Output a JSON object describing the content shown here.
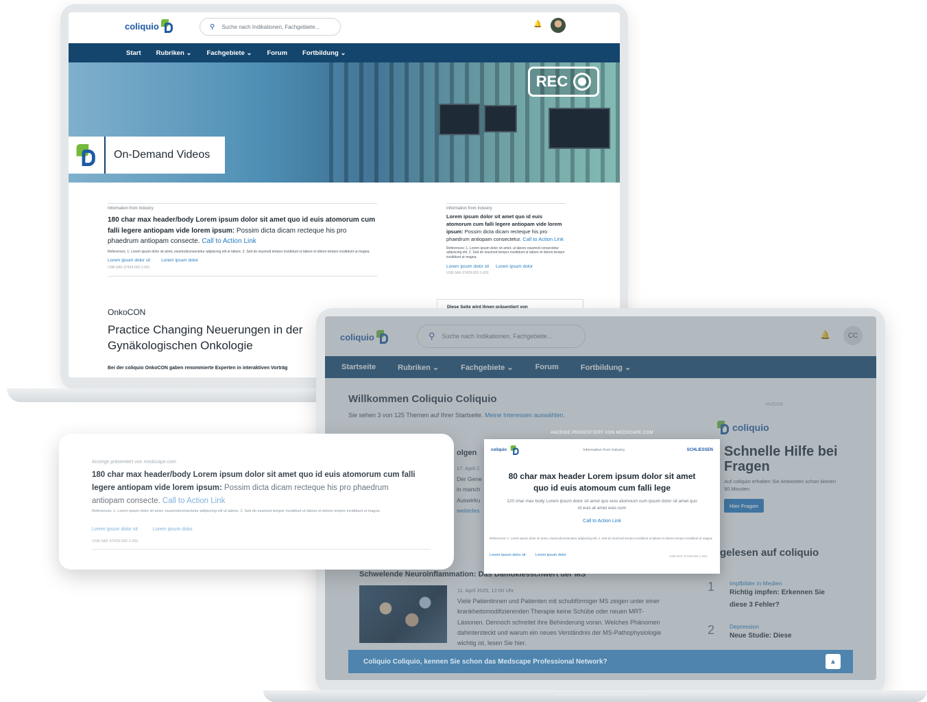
{
  "screen1": {
    "logo": "coliquio",
    "search_placeholder": "Suche nach Indikationen, Fachgebiete...",
    "nav": [
      "Start",
      "Rubriken ⌄",
      "Fachgebiete ⌄",
      "Forum",
      "Fortbildung ⌄"
    ],
    "hero": {
      "rec_label": "REC",
      "tag": "On-Demand Videos"
    },
    "card1": {
      "kicker": "Information from Industry",
      "headline_bold": "180 char max header/body Lorem ipsum dolor sit amet quo id euis atomorum cum falli legere antiopam vide lorem ipsum:",
      "headline_rest": " Possim dicta dicam recteque his pro phaedrum antiopam consecte. ",
      "cta": "Call to Action Link",
      "references": "References: 1. Lorem ipsum dolor sit amet, eiusmodconsectetur adipiscing elit ut labore. 2. Sed do eiusmod tempor incididunt ut labore et dolore tempor incididunt ut magna.",
      "links": [
        "Lorem ipsum dolor sit",
        "Lorem ipsum dolor"
      ],
      "code": "USB-SAF-37429-002-1-001"
    },
    "card2": {
      "kicker": "Information from Industry",
      "headline_bold": "Lorem ipsum dolor sit amet quo id euis atomorum cum falli legere antiopam vide lorem ipsum:",
      "headline_rest": " Possim dicta dicam recteque his pro phaedrum antiopam consectetur. ",
      "cta": "Call to Action Link",
      "references": "References: 1. Lorem ipsum dolor sit amet, ut labore eiusmod consectetur adipiscing elit. 2. Sed do eiusmod tempor incididunt ut labore et dolore tempor incididunt ut magna.",
      "links": [
        "Lorem ipsum dolor sit",
        "Lorem ipsum dolor"
      ],
      "code": "USB-SAF-37429-002-1-001"
    },
    "presented_by": "Diese Seite wird Ihnen präsentiert von",
    "onko": {
      "label": "OnkoCON",
      "title": "Practice Changing Neuerungen in der Gynäkologischen Onkologie",
      "text": "Bei der coliquio OnkoCON gaben renommierte Experten in interaktiven Vorträg"
    }
  },
  "screen2": {
    "logo": "coliquio",
    "search_placeholder": "Suche nach Indikationen, Fachgebiete...",
    "avatar_initials": "CC",
    "nav": [
      "Startseite",
      "Rubriken ⌄",
      "Fachgebiete ⌄",
      "Forum",
      "Fortbildung ⌄"
    ],
    "welcome": "Willkommen Coliquio Coliquio",
    "subline_text": "Sie sehen 3 von 125 Themen auf Ihrer Startseite. ",
    "subline_link": "Meine Interessen auswählen.",
    "anzeige": "ANZEIGE",
    "feature": {
      "title_fragment": "olgen",
      "date": "17. April 2",
      "lines": [
        "Der Gene",
        "in manch",
        "Auswirku",
        "weiterles"
      ]
    },
    "sidebar": {
      "logo": "coliquio",
      "help_title": "Schnelle Hilfe bei Fragen",
      "help_sub": "Auf coliquio erhalten Sie Antworten schon binnen 90 Minuten",
      "help_button": "Hier Fragen",
      "read_title": "gelesen auf coliquio",
      "ranked": [
        {
          "rank": "1",
          "category": "Impfbilder in Medien",
          "title": "Richtig impfen: Erkennen Sie diese 3 Fehler?"
        },
        {
          "rank": "2",
          "category": "Depression",
          "title": "Neue Studie: Diese"
        }
      ]
    },
    "article": {
      "title": "Schwelende Neuroinflammation: Das Damoklesschwert der MS",
      "date": "11. April 2025, 12:00 Uhr",
      "body": "Viele Patientinnen und Patienten mit schubförmiger MS zeigen unter einer krankheitsmodifizierenden Therapie keine Schübe oder neuen MRT-Läsionen. Dennoch schreitet ihre Behinderung voran. Welches Phänomen dahintersteckt und warum ein neues Verständnis der MS-Pathophysiologie wichtig ist, lesen Sie hier."
    },
    "banner": "Coliquio Coliquio, kennen Sie schon das Medscape Professional Network?"
  },
  "ad_modal": {
    "label": "ANZEIGE PRÄSENTIERT VON MEDSCAPE.COM",
    "close": "SCHLIESSEN",
    "top_text": "Information from Industry",
    "headline": "80 char max header Lorem ipsum dolor sit amet quo id euis atomoum cum falli lege",
    "body": "120 char max body Lorem ipsum dolor sit amet quo euis atomoum cum ipsum dolor sit amet quo id euis at amet euis cum",
    "cta": "Call to Action Link",
    "references": "References: 1. Lorem ipsum dolor sit amet, eiusmodconsectetur adipiscing elit. 2. Sed do eiusmod tempor incididunt ut labore et dolore tempor incididunt ut magna.",
    "links": [
      "Lorem ipsum dolor sit",
      "Lorem ipsum dolor"
    ],
    "code": "USB-SAF-37429-002-1-001"
  },
  "floating_card": {
    "presented": "Anzeige präsentiert von medscape.com",
    "headline_bold": "180 char max header/body Lorem ipsum dolor sit amet quo id euis atomorum cum falli legere antiopam vide lorem ipsum:",
    "headline_rest": " Possim dicta dicam recteque his pro phaedrum antiopam consecte. ",
    "cta": "Call to Action Link",
    "references": "References: 1. Lorem ipsum dolor sit amet, eiusmodconsectetur adipiscing elit ut labore. 2. Sed do eiusmod tempor incididunt ut labore et dolore tempor incididunt ut magna.",
    "links": [
      "Lorem ipsum dolor sit",
      "Lorem ipsum dolor"
    ],
    "code": "USB-SAF-37429-002-1-001"
  }
}
